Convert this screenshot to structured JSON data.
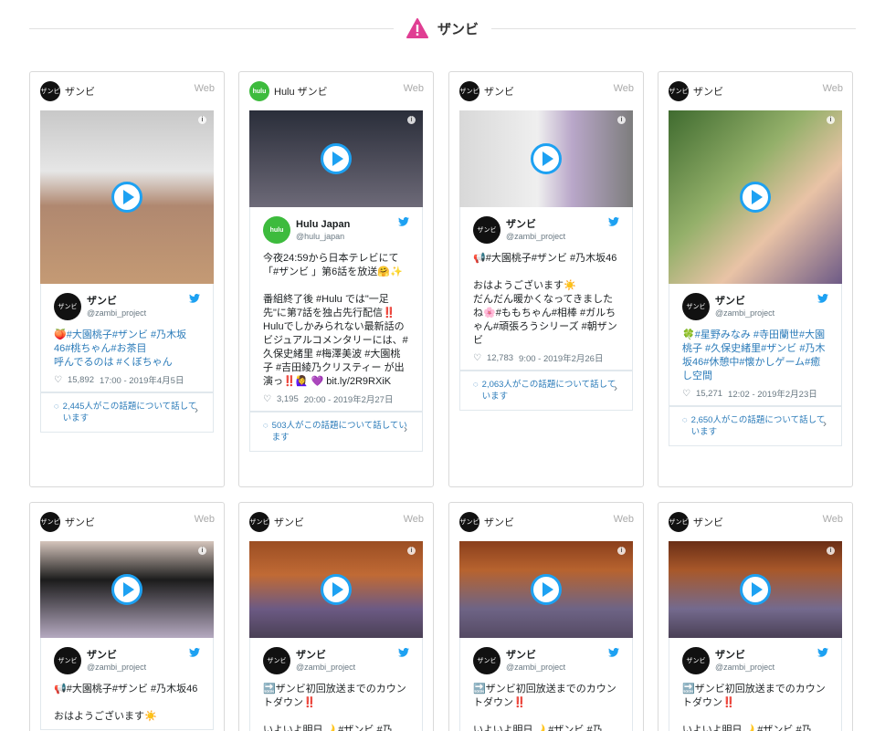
{
  "header": {
    "title": "ザンビ"
  },
  "cards": [
    {
      "source": "ザンビ",
      "web": "Web",
      "tweet": {
        "name": "ザンビ",
        "handle": "@zambi_project",
        "text": "🍑#大園桃子#ザンビ #乃木坂46#桃ちゃん#お茶目\n呼んでるのは #くぼちゃん",
        "likes": "15,892",
        "time": "17:00 - 2019年4月5日"
      },
      "talk": "2,445人がこの話題について話しています"
    },
    {
      "source": "Hulu ザンビ",
      "web": "Web",
      "tweet": {
        "name": "Hulu Japan",
        "handle": "@hulu_japan",
        "text": "今夜24:59から日本テレビにて「#ザンビ 」第6話を放送🤗✨\n\n番組終了後 #Hulu では\"一足先\"に第7話を独占先行配信‼️\nHuluでしかみられない最新話のビジュアルコメンタリーには、#久保史緒里 #梅澤美波 #大園桃子 #吉田綾乃クリスティー が出演っ‼️🙋‍♀️ 💜 bit.ly/2R9RXiK",
        "likes": "3,195",
        "time": "20:00 - 2019年2月27日"
      },
      "talk": "503人がこの話題について話しています"
    },
    {
      "source": "ザンビ",
      "web": "Web",
      "tweet": {
        "name": "ザンビ",
        "handle": "@zambi_project",
        "text": "📢#大園桃子#ザンビ #乃木坂46\n\nおはようございます☀️\nだんだん暖かくなってきましたね🌸#ももちゃん#相棒 #ガルちゃん#頑張ろうシリーズ #朝ザンビ",
        "likes": "12,783",
        "time": "9:00 - 2019年2月26日"
      },
      "talk": "2,063人がこの話題について話しています"
    },
    {
      "source": "ザンビ",
      "web": "Web",
      "tweet": {
        "name": "ザンビ",
        "handle": "@zambi_project",
        "text": "🍀#星野みなみ #寺田蘭世#大園桃子 #久保史緒里#ザンビ #乃木坂46#休憩中#懐かしゲーム#癒し空間",
        "likes": "15,271",
        "time": "12:02 - 2019年2月23日"
      },
      "talk": "2,650人がこの話題について話しています"
    },
    {
      "source": "ザンビ",
      "web": "Web",
      "tweet": {
        "name": "ザンビ",
        "handle": "@zambi_project",
        "text": "📢#大園桃子#ザンビ #乃木坂46\n\nおはようございます☀️"
      }
    },
    {
      "source": "ザンビ",
      "web": "Web",
      "tweet": {
        "name": "ザンビ",
        "handle": "@zambi_project",
        "text": "🔜ザンビ初回放送までのカウントダウン‼️\n\nいよいよ明日🌙 #ザンビ #乃"
      }
    },
    {
      "source": "ザンビ",
      "web": "Web",
      "tweet": {
        "name": "ザンビ",
        "handle": "@zambi_project",
        "text": "🔜ザンビ初回放送までのカウントダウン‼️\n\nいよいよ明日🌙 #ザンビ #乃"
      }
    },
    {
      "source": "ザンビ",
      "web": "Web",
      "tweet": {
        "name": "ザンビ",
        "handle": "@zambi_project",
        "text": "🔜ザンビ初回放送までのカウントダウン‼️\n\nいよいよ明日🌙 #ザンビ #乃"
      }
    }
  ]
}
